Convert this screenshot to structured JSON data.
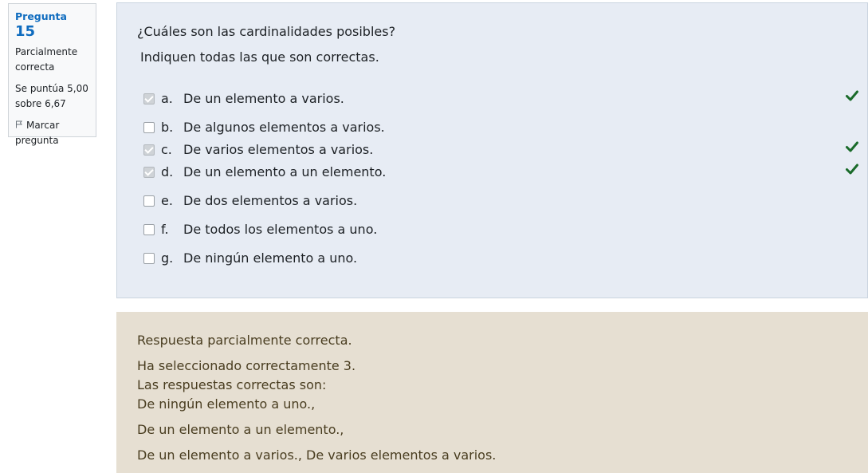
{
  "info": {
    "question_label": "Pregunta",
    "question_number": "15",
    "state_line1": "Parcialmente",
    "state_line2": "correcta",
    "grade_line1": "Se puntúa 5,00",
    "grade_line2": "sobre 6,67",
    "flag_line1": "Marcar",
    "flag_line2": "pregunta"
  },
  "question": {
    "text": "¿Cuáles son las cardinalidades posibles?",
    "prompt": "Indiquen todas las que son correctas.",
    "options": [
      {
        "letter": "a.",
        "text": "De un elemento a varios.",
        "checked": true,
        "correct": true
      },
      {
        "letter": "b.",
        "text": "De algunos elementos a varios.",
        "checked": false,
        "correct": false
      },
      {
        "letter": "c.",
        "text": "De varios elementos a varios.",
        "checked": true,
        "correct": true
      },
      {
        "letter": "d.",
        "text": "De un elemento a un elemento.",
        "checked": true,
        "correct": true
      },
      {
        "letter": "e.",
        "text": "De dos elementos a varios.",
        "checked": false,
        "correct": false
      },
      {
        "letter": "f.",
        "text": "De todos los elementos a uno.",
        "checked": false,
        "correct": false
      },
      {
        "letter": "g.",
        "text": "De ningún elemento a uno.",
        "checked": false,
        "correct": false
      }
    ]
  },
  "feedback": {
    "summary": "Respuesta parcialmente correcta.",
    "num_correct": "Ha seleccionado correctamente 3.",
    "right_answers_label": "Las respuestas correctas son:",
    "answer1": "De ningún elemento a uno.,",
    "answer2": "De un elemento a un elemento.,",
    "answer3": "De un elemento a varios., De varios elementos a varios."
  },
  "colors": {
    "accent": "#0f6cbf",
    "correct_tick": "#1a6b2a",
    "formulation_bg": "#e7ecf4",
    "feedback_bg": "#e6dfd2"
  }
}
